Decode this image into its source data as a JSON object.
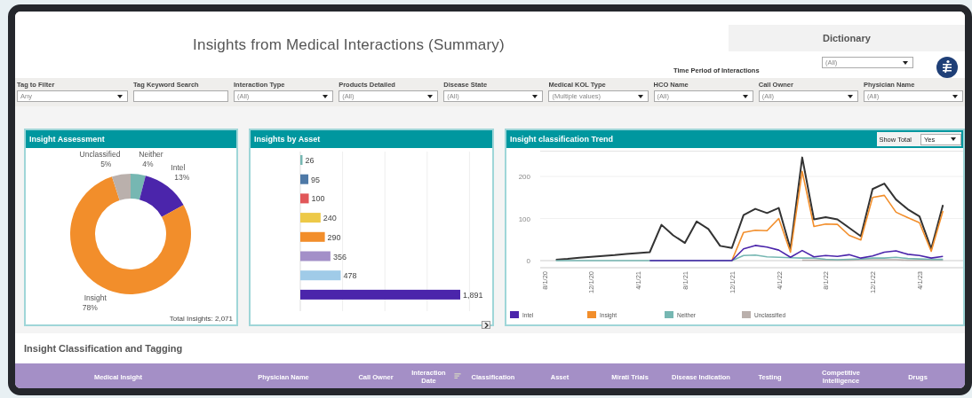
{
  "title": "Insights from Medical Interactions (Summary)",
  "dictionary": {
    "label": "Dictionary"
  },
  "time_period": {
    "label": "Time Period of Interactions",
    "value": "(All)"
  },
  "filters": [
    {
      "kind": "dropdown",
      "label": "Tag to Filter",
      "value": "Any"
    },
    {
      "kind": "text",
      "label": "Tag Keyword Search"
    },
    {
      "kind": "dropdown",
      "label": "Interaction Type",
      "value": "(All)"
    },
    {
      "kind": "dropdown",
      "label": "Products Detailed",
      "value": "(All)"
    },
    {
      "kind": "dropdown",
      "label": "Disease State",
      "value": "(All)"
    },
    {
      "kind": "dropdown",
      "label": "Medical KOL Type",
      "value": "(Multiple values)"
    },
    {
      "kind": "dropdown",
      "label": "HCO Name",
      "value": "(All)"
    },
    {
      "kind": "dropdown",
      "label": "Call Owner",
      "value": "(All)"
    },
    {
      "kind": "dropdown",
      "label": "Physician Name",
      "value": "(All)"
    }
  ],
  "assessment": {
    "title": "Insight Assessment",
    "total": "Total Insights: 2,071",
    "chart_data": {
      "type": "donut",
      "categories": [
        "Neither",
        "Intel",
        "Insight",
        "Unclassified"
      ],
      "values": [
        4,
        13,
        78,
        5
      ],
      "colors": [
        "#76b7b2",
        "#4b25ab",
        "#f28e2b",
        "#bab0ac"
      ],
      "value_labels": [
        "4%",
        "13%",
        "78%",
        "5%"
      ]
    }
  },
  "asset": {
    "title": "Insights by Asset",
    "chart_data": {
      "type": "bar",
      "orientation": "horizontal",
      "values": [
        26,
        95,
        100,
        240,
        290,
        356,
        478,
        1891
      ],
      "colors": [
        "#76b7b2",
        "#4e79a7",
        "#e15759",
        "#edc948",
        "#f28e2b",
        "#a38fc8",
        "#a0cbe8",
        "#4b25ab"
      ],
      "value_labels": [
        "26",
        "95",
        "100",
        "240",
        "290",
        "356",
        "478",
        "1,891"
      ]
    }
  },
  "trend": {
    "title": "Insight classification Trend",
    "show_total": {
      "label": "Show Total",
      "value": "Yes"
    },
    "chart_data": {
      "type": "line",
      "categories": [
        "8/1/20",
        null,
        null,
        null,
        "12/1/20",
        null,
        null,
        null,
        "4/1/21",
        null,
        null,
        null,
        "8/1/21",
        null,
        null,
        null,
        "12/1/21",
        null,
        null,
        null,
        "4/1/22",
        null,
        null,
        null,
        "8/1/22",
        null,
        null,
        null,
        "12/1/22",
        null,
        null,
        null,
        "4/1/23",
        null,
        null
      ],
      "ylim": [
        0,
        260
      ],
      "yticks": [
        0,
        100,
        200
      ],
      "legend": true,
      "series": [
        {
          "name": "Intel",
          "color": "#4b25ab",
          "values": [
            null,
            null,
            null,
            null,
            null,
            null,
            null,
            null,
            null,
            0,
            0,
            0,
            0,
            0,
            0,
            0,
            0,
            28,
            36,
            32,
            25,
            8,
            24,
            9,
            12,
            10,
            14,
            6,
            11,
            20,
            23,
            15,
            12,
            6,
            10
          ]
        },
        {
          "name": "Insight",
          "color": "#f28e2b",
          "values": [
            null,
            null,
            null,
            null,
            null,
            null,
            null,
            null,
            null,
            null,
            null,
            null,
            null,
            null,
            null,
            null,
            0,
            67,
            72,
            71,
            100,
            20,
            212,
            81,
            87,
            86,
            60,
            49,
            150,
            155,
            115,
            102,
            90,
            22,
            118
          ]
        },
        {
          "name": "Neither",
          "color": "#76b7b2",
          "values": [
            null,
            0,
            0,
            0,
            0,
            0,
            0,
            0,
            0,
            0,
            0,
            0,
            0,
            0,
            0,
            0,
            0,
            12,
            13,
            9,
            8,
            7,
            6,
            6,
            3,
            2,
            3,
            4,
            6,
            6,
            8,
            5,
            4,
            3,
            3
          ]
        },
        {
          "name": "Unclassified",
          "color": "#bab0ac",
          "values": [
            null,
            null,
            null,
            null,
            null,
            null,
            null,
            null,
            null,
            null,
            null,
            null,
            null,
            null,
            null,
            null,
            null,
            null,
            null,
            null,
            null,
            null,
            1,
            1,
            1,
            1,
            1,
            2,
            2,
            2,
            2,
            1,
            1,
            1,
            1
          ]
        },
        {
          "color": "#333333",
          "values": [
            null,
            2,
            4,
            7,
            9,
            11,
            13,
            16,
            18,
            20,
            85,
            60,
            42,
            93,
            75,
            35,
            30,
            108,
            123,
            113,
            125,
            28,
            245,
            98,
            103,
            98,
            78,
            58,
            170,
            183,
            145,
            122,
            105,
            28,
            132
          ]
        }
      ]
    }
  },
  "tagging": {
    "title": "Insight Classification and Tagging",
    "columns": [
      {
        "label": "Medical Insight",
        "sorted": false
      },
      {
        "label": "Physician Name",
        "sorted": false
      },
      {
        "label": "Call Owner",
        "sorted": false
      },
      {
        "label": "Interaction Date",
        "sorted": true
      },
      {
        "label": "Classification",
        "sorted": false
      },
      {
        "label": "Asset",
        "sorted": false
      },
      {
        "label": "Mirati Trials",
        "sorted": false
      },
      {
        "label": "Disease Indication",
        "sorted": false
      },
      {
        "label": "Testing",
        "sorted": false
      },
      {
        "label": "Competitive Intelligence",
        "sorted": false
      },
      {
        "label": "Drugs",
        "sorted": false
      }
    ]
  }
}
